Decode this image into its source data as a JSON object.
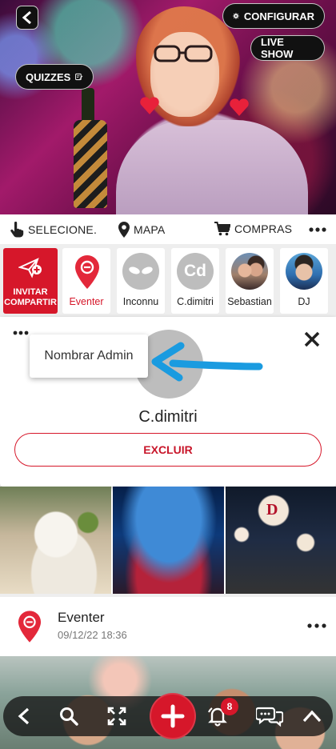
{
  "hero": {
    "configure_label": "CONFIGURAR",
    "live_show_label": "LIVE SHOW",
    "quizzes_label": "QUIZZES"
  },
  "actionbar": {
    "select_label": "SELECIONE.",
    "map_label": "MAPA",
    "shop_label": "COMPRAS"
  },
  "strip": {
    "invite_line1": "INVITAR",
    "invite_line2": "COMPARTIR",
    "cards": [
      {
        "label": "Eventer",
        "kind": "pin",
        "color": "#e3283a"
      },
      {
        "label": "Inconnu",
        "kind": "alien"
      },
      {
        "label": "C.dimitri",
        "kind": "initials",
        "initials": "Cd"
      },
      {
        "label": "Sebastian",
        "kind": "photo"
      },
      {
        "label": "DJ",
        "kind": "photo"
      }
    ]
  },
  "panel": {
    "name": "C.dimitri",
    "tooltip": "Nombrar Admin",
    "delete_label": "EXCLUIR"
  },
  "post": {
    "author": "Eventer",
    "timestamp": "09/12/22 18:36"
  },
  "bottomnav": {
    "notifications_count": "8"
  },
  "colors": {
    "brand_red": "#d6172a",
    "arrow_blue": "#1a9be0"
  }
}
